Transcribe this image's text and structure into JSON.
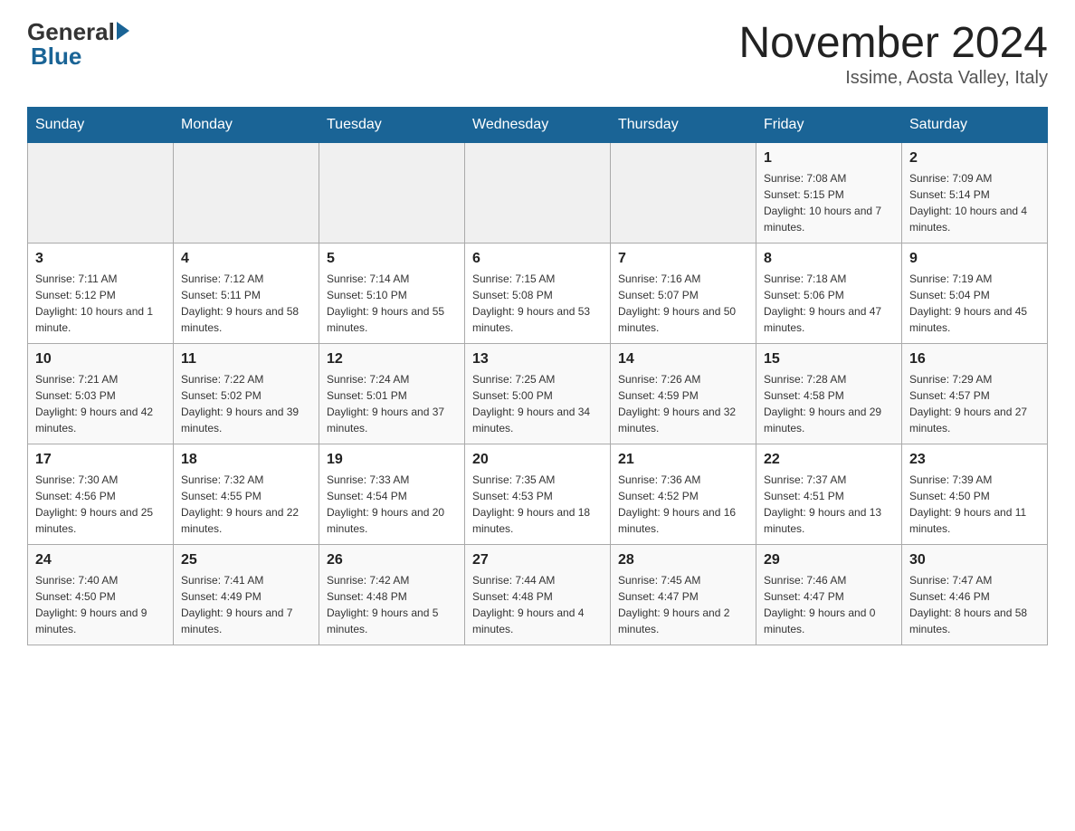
{
  "header": {
    "logo_general": "General",
    "logo_blue": "Blue",
    "month_title": "November 2024",
    "location": "Issime, Aosta Valley, Italy"
  },
  "days_of_week": [
    "Sunday",
    "Monday",
    "Tuesday",
    "Wednesday",
    "Thursday",
    "Friday",
    "Saturday"
  ],
  "weeks": [
    [
      {
        "day": "",
        "info": ""
      },
      {
        "day": "",
        "info": ""
      },
      {
        "day": "",
        "info": ""
      },
      {
        "day": "",
        "info": ""
      },
      {
        "day": "",
        "info": ""
      },
      {
        "day": "1",
        "info": "Sunrise: 7:08 AM\nSunset: 5:15 PM\nDaylight: 10 hours and 7 minutes."
      },
      {
        "day": "2",
        "info": "Sunrise: 7:09 AM\nSunset: 5:14 PM\nDaylight: 10 hours and 4 minutes."
      }
    ],
    [
      {
        "day": "3",
        "info": "Sunrise: 7:11 AM\nSunset: 5:12 PM\nDaylight: 10 hours and 1 minute."
      },
      {
        "day": "4",
        "info": "Sunrise: 7:12 AM\nSunset: 5:11 PM\nDaylight: 9 hours and 58 minutes."
      },
      {
        "day": "5",
        "info": "Sunrise: 7:14 AM\nSunset: 5:10 PM\nDaylight: 9 hours and 55 minutes."
      },
      {
        "day": "6",
        "info": "Sunrise: 7:15 AM\nSunset: 5:08 PM\nDaylight: 9 hours and 53 minutes."
      },
      {
        "day": "7",
        "info": "Sunrise: 7:16 AM\nSunset: 5:07 PM\nDaylight: 9 hours and 50 minutes."
      },
      {
        "day": "8",
        "info": "Sunrise: 7:18 AM\nSunset: 5:06 PM\nDaylight: 9 hours and 47 minutes."
      },
      {
        "day": "9",
        "info": "Sunrise: 7:19 AM\nSunset: 5:04 PM\nDaylight: 9 hours and 45 minutes."
      }
    ],
    [
      {
        "day": "10",
        "info": "Sunrise: 7:21 AM\nSunset: 5:03 PM\nDaylight: 9 hours and 42 minutes."
      },
      {
        "day": "11",
        "info": "Sunrise: 7:22 AM\nSunset: 5:02 PM\nDaylight: 9 hours and 39 minutes."
      },
      {
        "day": "12",
        "info": "Sunrise: 7:24 AM\nSunset: 5:01 PM\nDaylight: 9 hours and 37 minutes."
      },
      {
        "day": "13",
        "info": "Sunrise: 7:25 AM\nSunset: 5:00 PM\nDaylight: 9 hours and 34 minutes."
      },
      {
        "day": "14",
        "info": "Sunrise: 7:26 AM\nSunset: 4:59 PM\nDaylight: 9 hours and 32 minutes."
      },
      {
        "day": "15",
        "info": "Sunrise: 7:28 AM\nSunset: 4:58 PM\nDaylight: 9 hours and 29 minutes."
      },
      {
        "day": "16",
        "info": "Sunrise: 7:29 AM\nSunset: 4:57 PM\nDaylight: 9 hours and 27 minutes."
      }
    ],
    [
      {
        "day": "17",
        "info": "Sunrise: 7:30 AM\nSunset: 4:56 PM\nDaylight: 9 hours and 25 minutes."
      },
      {
        "day": "18",
        "info": "Sunrise: 7:32 AM\nSunset: 4:55 PM\nDaylight: 9 hours and 22 minutes."
      },
      {
        "day": "19",
        "info": "Sunrise: 7:33 AM\nSunset: 4:54 PM\nDaylight: 9 hours and 20 minutes."
      },
      {
        "day": "20",
        "info": "Sunrise: 7:35 AM\nSunset: 4:53 PM\nDaylight: 9 hours and 18 minutes."
      },
      {
        "day": "21",
        "info": "Sunrise: 7:36 AM\nSunset: 4:52 PM\nDaylight: 9 hours and 16 minutes."
      },
      {
        "day": "22",
        "info": "Sunrise: 7:37 AM\nSunset: 4:51 PM\nDaylight: 9 hours and 13 minutes."
      },
      {
        "day": "23",
        "info": "Sunrise: 7:39 AM\nSunset: 4:50 PM\nDaylight: 9 hours and 11 minutes."
      }
    ],
    [
      {
        "day": "24",
        "info": "Sunrise: 7:40 AM\nSunset: 4:50 PM\nDaylight: 9 hours and 9 minutes."
      },
      {
        "day": "25",
        "info": "Sunrise: 7:41 AM\nSunset: 4:49 PM\nDaylight: 9 hours and 7 minutes."
      },
      {
        "day": "26",
        "info": "Sunrise: 7:42 AM\nSunset: 4:48 PM\nDaylight: 9 hours and 5 minutes."
      },
      {
        "day": "27",
        "info": "Sunrise: 7:44 AM\nSunset: 4:48 PM\nDaylight: 9 hours and 4 minutes."
      },
      {
        "day": "28",
        "info": "Sunrise: 7:45 AM\nSunset: 4:47 PM\nDaylight: 9 hours and 2 minutes."
      },
      {
        "day": "29",
        "info": "Sunrise: 7:46 AM\nSunset: 4:47 PM\nDaylight: 9 hours and 0 minutes."
      },
      {
        "day": "30",
        "info": "Sunrise: 7:47 AM\nSunset: 4:46 PM\nDaylight: 8 hours and 58 minutes."
      }
    ]
  ]
}
